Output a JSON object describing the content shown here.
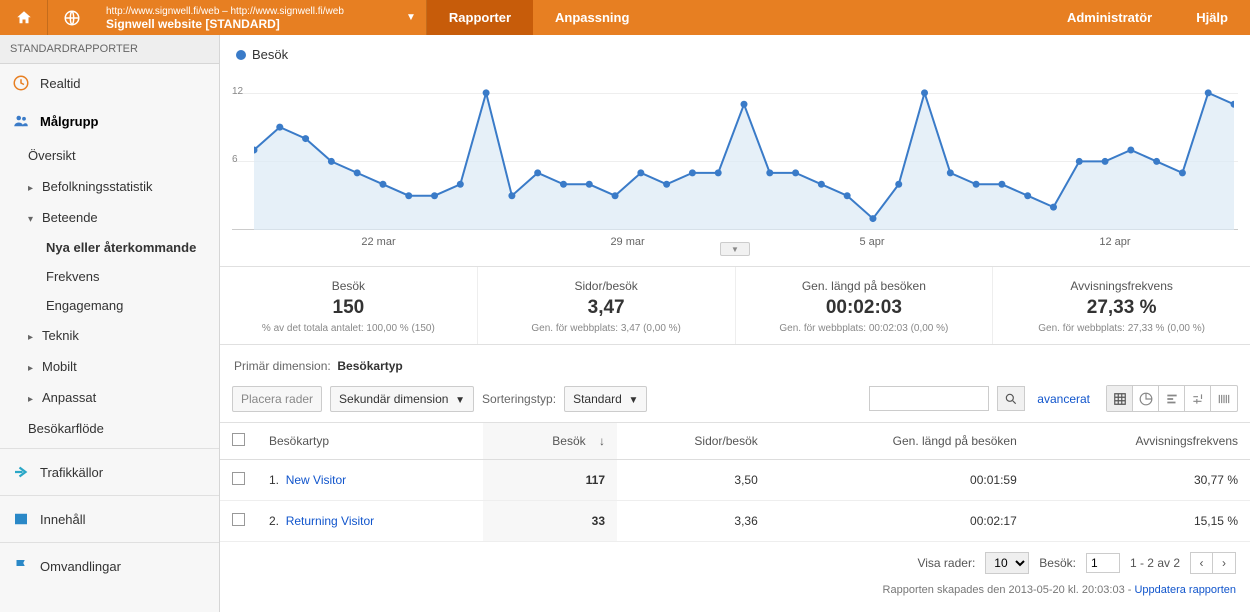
{
  "topbar": {
    "url": "http://www.signwell.fi/web – http://www.signwell.fi/web",
    "site": "Signwell website [STANDARD]",
    "tab_reports": "Rapporter",
    "tab_customize": "Anpassning",
    "tab_admin": "Administratör",
    "tab_help": "Hjälp"
  },
  "sidebar": {
    "title": "STANDARDRAPPORTER",
    "realtime": "Realtid",
    "audience": "Målgrupp",
    "overview": "Översikt",
    "demographics": "Befolkningsstatistik",
    "behavior": "Beteende",
    "new_vs_returning": "Nya eller återkommande",
    "frequency": "Frekvens",
    "engagement": "Engagemang",
    "technology": "Teknik",
    "mobile": "Mobilt",
    "custom": "Anpassat",
    "visitor_flow": "Besökarflöde",
    "traffic": "Trafikkällor",
    "content": "Innehåll",
    "conversions": "Omvandlingar"
  },
  "chart_data": {
    "type": "line",
    "series_name": "Besök",
    "ylim": [
      0,
      14
    ],
    "yticks": [
      6,
      12
    ],
    "x_labels": [
      "22 mar",
      "29 mar",
      "5 apr",
      "12 apr"
    ],
    "values": [
      7,
      9,
      8,
      6,
      5,
      4,
      3,
      3,
      4,
      12,
      3,
      5,
      4,
      4,
      3,
      5,
      4,
      5,
      5,
      11,
      5,
      5,
      4,
      3,
      1,
      4,
      12,
      5,
      4,
      4,
      3,
      2,
      6,
      6,
      7,
      6,
      5,
      12,
      11
    ]
  },
  "metrics": [
    {
      "label": "Besök",
      "value": "150",
      "sub": "% av det totala antalet: 100,00 % (150)"
    },
    {
      "label": "Sidor/besök",
      "value": "3,47",
      "sub": "Gen. för webbplats: 3,47 (0,00 %)"
    },
    {
      "label": "Gen. längd på besöken",
      "value": "00:02:03",
      "sub": "Gen. för webbplats: 00:02:03 (0,00 %)"
    },
    {
      "label": "Avvisningsfrekvens",
      "value": "27,33 %",
      "sub": "Gen. för webbplats: 27,33 % (0,00 %)"
    }
  ],
  "dimension": {
    "label": "Primär dimension:",
    "value": "Besökartyp"
  },
  "controls": {
    "place": "Placera rader",
    "secondary": "Sekundär dimension",
    "sort_label": "Sorteringstyp:",
    "sort_value": "Standard",
    "advanced": "avancerat"
  },
  "table": {
    "headers": {
      "type": "Besökartyp",
      "visits": "Besök",
      "pages": "Sidor/besök",
      "duration": "Gen. längd på besöken",
      "bounce": "Avvisningsfrekvens"
    },
    "rows": [
      {
        "idx": "1.",
        "name": "New Visitor",
        "visits": "117",
        "pages": "3,50",
        "duration": "00:01:59",
        "bounce": "30,77 %"
      },
      {
        "idx": "2.",
        "name": "Returning Visitor",
        "visits": "33",
        "pages": "3,36",
        "duration": "00:02:17",
        "bounce": "15,15 %"
      }
    ]
  },
  "footer": {
    "show_rows": "Visa rader:",
    "rows_val": "10",
    "visits_label": "Besök:",
    "visits_val": "1",
    "range": "1 - 2 av 2"
  },
  "generated": {
    "text": "Rapporten skapades den 2013-05-20 kl. 20:03:03 - ",
    "link": "Uppdatera rapporten"
  }
}
